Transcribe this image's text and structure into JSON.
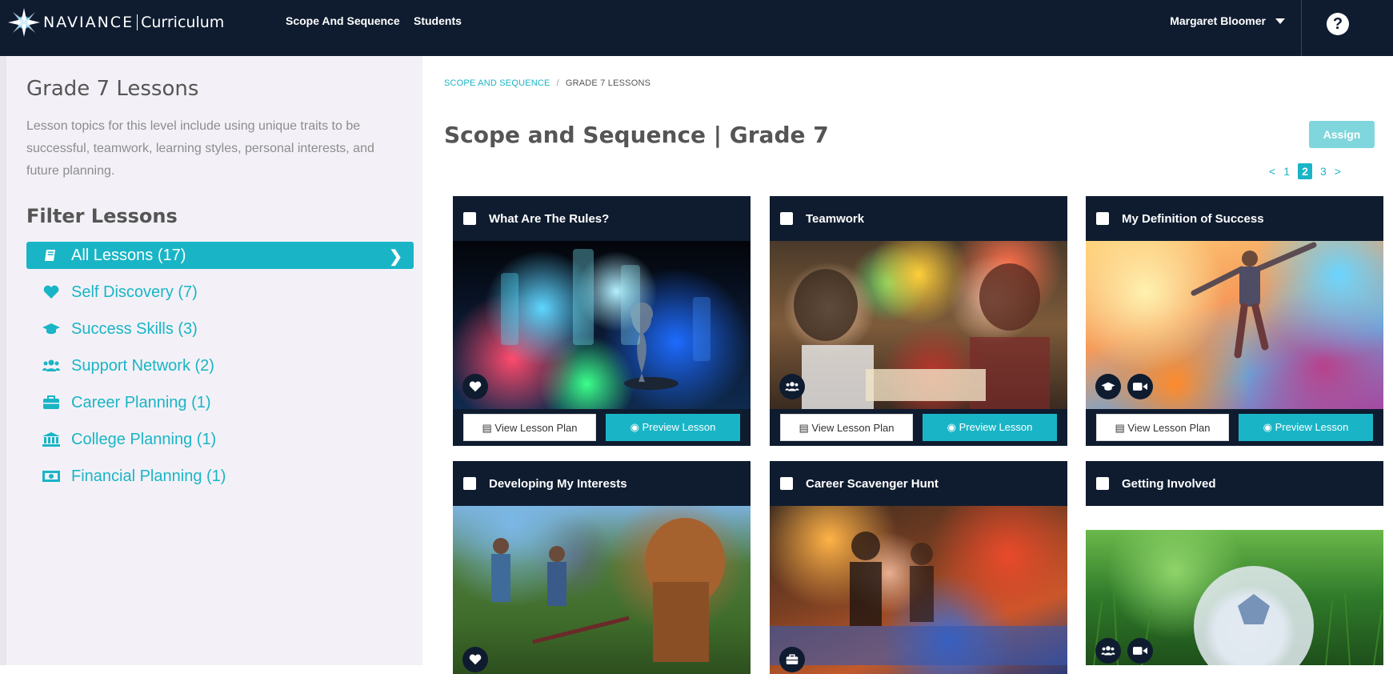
{
  "header": {
    "brand": "NAVIANCE",
    "product": "Curriculum",
    "nav": [
      "Scope And Sequence",
      "Students"
    ],
    "user": "Margaret Bloomer",
    "help": "?"
  },
  "sidebar": {
    "title": "Grade 7 Lessons",
    "description": "Lesson topics for this level include using unique traits to be successful, teamwork, learning styles, personal interests, and future planning.",
    "filter_title": "Filter Lessons",
    "filters": [
      {
        "label": "All Lessons (17)",
        "icon": "book-icon",
        "active": true
      },
      {
        "label": "Self Discovery (7)",
        "icon": "heart-icon"
      },
      {
        "label": "Success Skills (3)",
        "icon": "graduation-cap-icon"
      },
      {
        "label": "Support Network (2)",
        "icon": "group-icon"
      },
      {
        "label": "Career Planning (1)",
        "icon": "briefcase-icon"
      },
      {
        "label": "College Planning (1)",
        "icon": "institution-icon"
      },
      {
        "label": "Financial Planning (1)",
        "icon": "money-icon"
      }
    ]
  },
  "main": {
    "breadcrumb": {
      "link": "SCOPE AND SEQUENCE",
      "sep": "/",
      "current": "GRADE 7 LESSONS"
    },
    "title": "Scope and Sequence | Grade 7",
    "assign": "Assign",
    "pager": {
      "prev": "<",
      "pages": [
        "1",
        "2",
        "3"
      ],
      "current": "2",
      "next": ">"
    },
    "view_plan_label": "View Lesson Plan",
    "preview_label": "Preview Lesson",
    "cards": [
      {
        "title": "What Are The Rules?",
        "badges": [
          "heart-icon"
        ]
      },
      {
        "title": "Teamwork",
        "badges": [
          "group-icon"
        ]
      },
      {
        "title": "My Definition of Success",
        "badges": [
          "graduation-cap-icon",
          "video-camera-icon"
        ]
      },
      {
        "title": "Developing My Interests",
        "badges": [
          "heart-icon"
        ]
      },
      {
        "title": "Career Scavenger Hunt",
        "badges": [
          "briefcase-icon"
        ]
      },
      {
        "title": "Getting Involved",
        "badges": [
          "group-icon",
          "video-camera-icon"
        ]
      }
    ]
  }
}
